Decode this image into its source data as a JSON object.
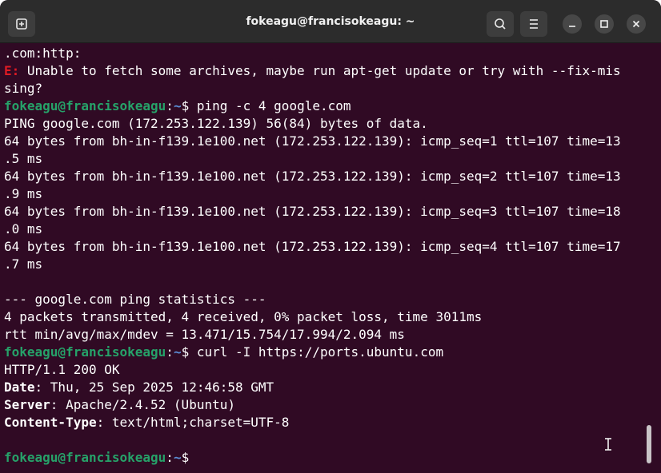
{
  "window": {
    "title": "fokeagu@francisokeagu: ~"
  },
  "terminal": {
    "lines": [
      {
        "type": "text",
        "text": ".com:http:"
      },
      {
        "type": "error",
        "prefix": "E:",
        "text": " Unable to fetch some archives, maybe run apt-get update or try with --fix-mis"
      },
      {
        "type": "text",
        "text": "sing?"
      },
      {
        "type": "prompt",
        "user": "fokeagu@francisokeagu",
        "sep": ":",
        "path": "~",
        "symbol": "$ ",
        "command": "ping -c 4 google.com"
      },
      {
        "type": "text",
        "text": "PING google.com (172.253.122.139) 56(84) bytes of data."
      },
      {
        "type": "text",
        "text": "64 bytes from bh-in-f139.1e100.net (172.253.122.139): icmp_seq=1 ttl=107 time=13"
      },
      {
        "type": "text",
        "text": ".5 ms"
      },
      {
        "type": "text",
        "text": "64 bytes from bh-in-f139.1e100.net (172.253.122.139): icmp_seq=2 ttl=107 time=13"
      },
      {
        "type": "text",
        "text": ".9 ms"
      },
      {
        "type": "text",
        "text": "64 bytes from bh-in-f139.1e100.net (172.253.122.139): icmp_seq=3 ttl=107 time=18"
      },
      {
        "type": "text",
        "text": ".0 ms"
      },
      {
        "type": "text",
        "text": "64 bytes from bh-in-f139.1e100.net (172.253.122.139): icmp_seq=4 ttl=107 time=17"
      },
      {
        "type": "text",
        "text": ".7 ms"
      },
      {
        "type": "text",
        "text": ""
      },
      {
        "type": "text",
        "text": "--- google.com ping statistics ---"
      },
      {
        "type": "text",
        "text": "4 packets transmitted, 4 received, 0% packet loss, time 3011ms"
      },
      {
        "type": "text",
        "text": "rtt min/avg/max/mdev = 13.471/15.754/17.994/2.094 ms"
      },
      {
        "type": "prompt",
        "user": "fokeagu@francisokeagu",
        "sep": ":",
        "path": "~",
        "symbol": "$ ",
        "command": "curl -I https://ports.ubuntu.com"
      },
      {
        "type": "text",
        "text": "HTTP/1.1 200 OK"
      },
      {
        "type": "header",
        "key": "Date",
        "value": ": Thu, 25 Sep 2025 12:46:58 GMT"
      },
      {
        "type": "header",
        "key": "Server",
        "value": ": Apache/2.4.52 (Ubuntu)"
      },
      {
        "type": "header",
        "key": "Content-Type",
        "value": ": text/html;charset=UTF-8"
      },
      {
        "type": "text",
        "text": ""
      },
      {
        "type": "prompt",
        "user": "fokeagu@francisokeagu",
        "sep": ":",
        "path": "~",
        "symbol": "$",
        "command": ""
      }
    ]
  },
  "icons": {
    "new_tab": "new-tab-icon",
    "search": "search-icon",
    "menu": "hamburger-menu-icon",
    "minimize": "minimize-icon",
    "maximize": "maximize-icon",
    "close": "close-icon",
    "cursor": "text-cursor-icon"
  },
  "colors": {
    "background": "#300a24",
    "titlebar": "#2c2c2c",
    "prompt_user": "#26a269",
    "prompt_path": "#5b8ed6",
    "error": "#e01b24",
    "text": "#ffffff"
  }
}
